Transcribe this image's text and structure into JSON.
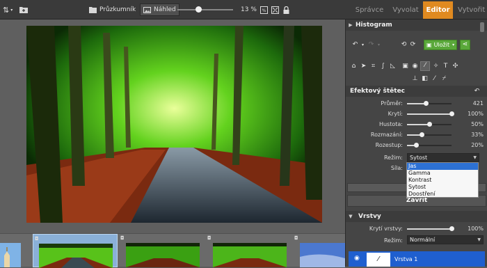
{
  "toolbar": {
    "sort_icon": "sort-icon",
    "add_icon": "add-folder-icon",
    "explorer_label": "Průzkumník",
    "preview_label": "Náhled",
    "zoom": "13 %",
    "zoom_fraction": 0.13
  },
  "tabs": [
    {
      "label": "Správce",
      "active": false
    },
    {
      "label": "Vyvolat",
      "active": false
    },
    {
      "label": "Editor",
      "active": true
    },
    {
      "label": "Vytvořit",
      "active": false
    }
  ],
  "panel": {
    "histogram_title": "Histogram",
    "save_label": "Uložit",
    "brush_title": "Efektový štětec",
    "sliders": [
      {
        "label": "Průměr:",
        "value": "421",
        "fraction": 0.42
      },
      {
        "label": "Krytí:",
        "value": "100%",
        "fraction": 1.0
      },
      {
        "label": "Hustota:",
        "value": "50%",
        "fraction": 0.5
      },
      {
        "label": "Rozmazání:",
        "value": "33%",
        "fraction": 0.33
      },
      {
        "label": "Rozestup:",
        "value": "20%",
        "fraction": 0.2
      }
    ],
    "mode_label": "Režim:",
    "mode_value": "Sytost",
    "strength_label": "Síla:",
    "close_label": "Zavřít",
    "layers_title": "Vrstvy",
    "layer_opacity_label": "Krytí vrstvy:",
    "layer_opacity_value": "100%",
    "layer_opacity_fraction": 1.0,
    "layer_mode_label": "Režim:",
    "layer_mode_value": "Normální",
    "layer_name": "Vrstva 1"
  },
  "dropdown_options": [
    {
      "label": "Jas",
      "highlighted": true
    },
    {
      "label": "Gamma",
      "highlighted": false
    },
    {
      "label": "Kontrast",
      "highlighted": false
    },
    {
      "label": "Sytost",
      "highlighted": false
    },
    {
      "label": "Doostření",
      "highlighted": false
    }
  ],
  "colors": {
    "accent": "#e08a20",
    "save_green": "#5aa83a",
    "selection_blue": "#2d71d4",
    "layer_row_blue": "#1f5fcf"
  }
}
